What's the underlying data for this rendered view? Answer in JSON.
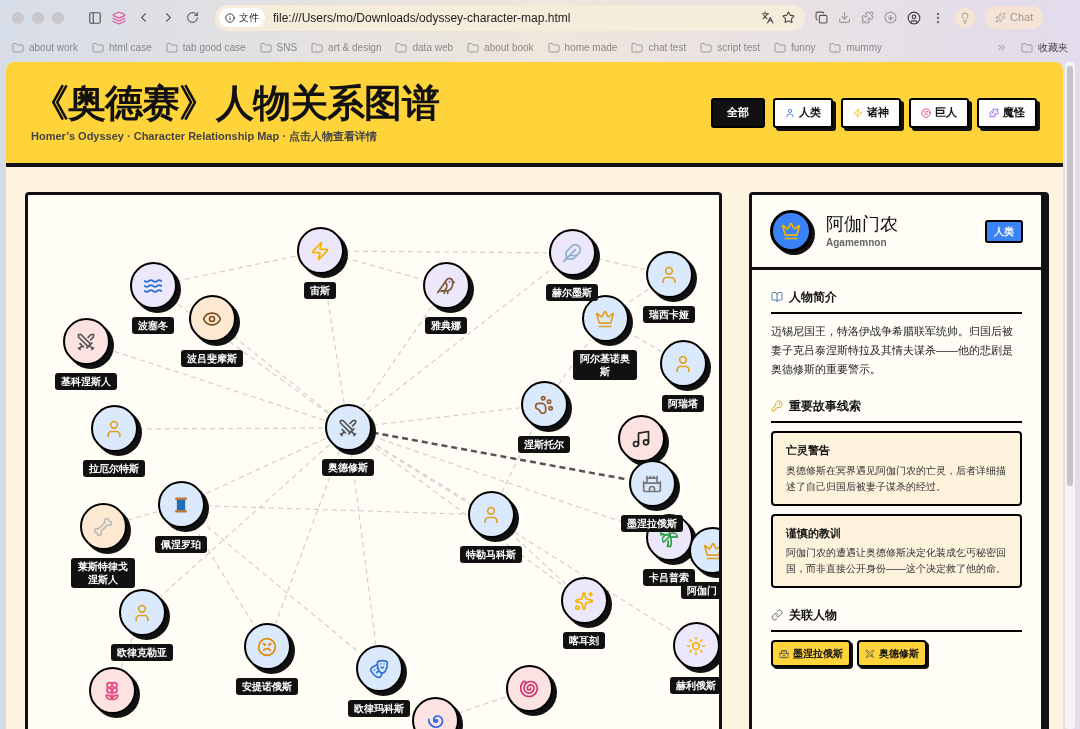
{
  "browser": {
    "url_chip": "文件",
    "url": "file:///Users/mo/Downloads/odyssey-character-map.html",
    "chat": "Chat",
    "bookmarks": [
      "about work",
      "html case",
      "tab good case",
      "SNS",
      "art & design",
      "data web",
      "about book",
      "home made",
      "chat test",
      "script test",
      "funny",
      "mummy"
    ],
    "bookmarks_folder": "收藏夹"
  },
  "header": {
    "title": "《奥德赛》人物关系图谱",
    "subtitle": "Homer’s Odyssey · Character Relationship Map · 点击人物查看详情",
    "filters": [
      {
        "label": "全部",
        "selected": true
      },
      {
        "label": "人类",
        "selected": false
      },
      {
        "label": "诸神",
        "selected": false
      },
      {
        "label": "巨人",
        "selected": false
      },
      {
        "label": "魔怪",
        "selected": false
      }
    ]
  },
  "graph": {
    "nodes": [
      {
        "label": "宙斯",
        "color": "#ede7fb"
      },
      {
        "label": "波塞冬",
        "color": "#ede7fb"
      },
      {
        "label": "波吕斐摩斯",
        "color": "#fde9d2"
      },
      {
        "label": "基科涅斯人",
        "color": "#fde2e2"
      },
      {
        "label": "雅典娜",
        "color": "#ede7fb"
      },
      {
        "label": "赫尔墨斯",
        "color": "#ede7fb"
      },
      {
        "label": "瑞西卡娅",
        "color": "#dbe9fc"
      },
      {
        "label": "阿尔基诺奥斯",
        "color": "#dbe9fc"
      },
      {
        "label": "阿瑞塔",
        "color": "#dbe9fc"
      },
      {
        "label": "拉厄尔特斯",
        "color": "#dbe9fc"
      },
      {
        "label": "奥德修斯",
        "color": "#dbe9fc"
      },
      {
        "label": "涅斯托尔",
        "color": "#dbe9fc"
      },
      {
        "color": "#fde2e2"
      },
      {
        "label": "墨涅拉俄斯",
        "color": "#dbe9fc"
      },
      {
        "label": "佩涅罗珀",
        "color": "#dbe9fc"
      },
      {
        "label": "莱斯特律戈涅斯人",
        "color": "#fde9d2"
      },
      {
        "label": "特勒马科斯",
        "color": "#dbe9fc"
      },
      {
        "label": "卡吕普索",
        "color": "#ede7fb"
      },
      {
        "label": "阿伽门",
        "color": "#dbe9fc"
      },
      {
        "label": "欧律克勒亚",
        "color": "#dbe9fc"
      },
      {
        "label": "喀耳刻",
        "color": "#ede7fb"
      },
      {
        "label": "安提诺俄斯",
        "color": "#dbe9fc"
      },
      {
        "label": "欧律玛科斯",
        "color": "#dbe9fc"
      },
      {
        "label": "赫利俄斯",
        "color": "#ede7fb"
      },
      {
        "color": "#fde2e2"
      },
      {
        "color": "#fde2e2"
      },
      {
        "color": "#fde2e2"
      }
    ]
  },
  "detail": {
    "name": "阿伽门农",
    "name_en": "Agamemnon",
    "tag": "人类",
    "sections": [
      {
        "kind": "bio",
        "heading": "人物简介",
        "text": "迈锡尼国王，特洛伊战争希腊联军统帅。归国后被妻子克吕泰涅斯特拉及其情夫谋杀——他的悲剧是奥德修斯的重要警示。"
      },
      {
        "kind": "clues",
        "heading": "重要故事线索",
        "cards": [
          {
            "title": "亡灵警告",
            "text": "奥德修斯在冥界遇见阿伽门农的亡灵，后者详细描述了自己归国后被妻子谋杀的经过。"
          },
          {
            "title": "谨慎的教训",
            "text": "阿伽门农的遭遇让奥德修斯决定化装成乞丐秘密回国，而非直接公开身份——这个决定救了他的命。"
          }
        ]
      },
      {
        "kind": "related",
        "heading": "关联人物",
        "chips": [
          "墨涅拉俄斯",
          "奥德修斯"
        ]
      }
    ]
  }
}
